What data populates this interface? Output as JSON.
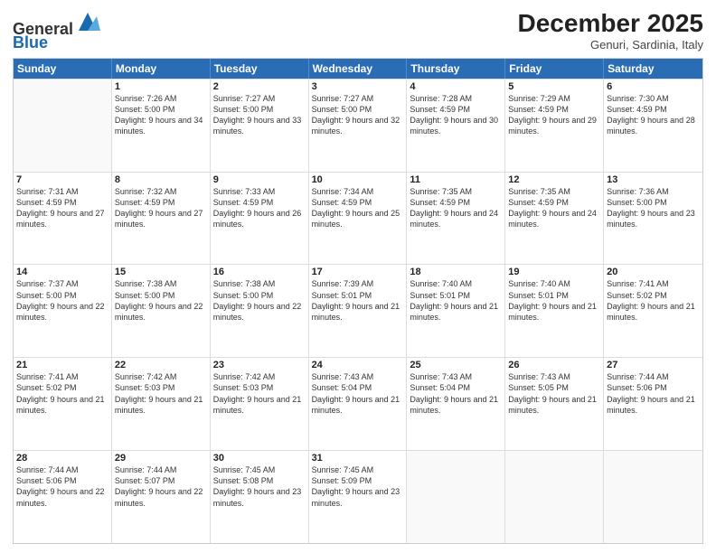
{
  "logo": {
    "general": "General",
    "blue": "Blue"
  },
  "title": "December 2025",
  "location": "Genuri, Sardinia, Italy",
  "days": [
    "Sunday",
    "Monday",
    "Tuesday",
    "Wednesday",
    "Thursday",
    "Friday",
    "Saturday"
  ],
  "weeks": [
    [
      {
        "num": "",
        "empty": true
      },
      {
        "num": "1",
        "sunrise": "7:26 AM",
        "sunset": "5:00 PM",
        "daylight": "9 hours and 34 minutes."
      },
      {
        "num": "2",
        "sunrise": "7:27 AM",
        "sunset": "5:00 PM",
        "daylight": "9 hours and 33 minutes."
      },
      {
        "num": "3",
        "sunrise": "7:27 AM",
        "sunset": "5:00 PM",
        "daylight": "9 hours and 32 minutes."
      },
      {
        "num": "4",
        "sunrise": "7:28 AM",
        "sunset": "4:59 PM",
        "daylight": "9 hours and 30 minutes."
      },
      {
        "num": "5",
        "sunrise": "7:29 AM",
        "sunset": "4:59 PM",
        "daylight": "9 hours and 29 minutes."
      },
      {
        "num": "6",
        "sunrise": "7:30 AM",
        "sunset": "4:59 PM",
        "daylight": "9 hours and 28 minutes."
      }
    ],
    [
      {
        "num": "7",
        "sunrise": "7:31 AM",
        "sunset": "4:59 PM",
        "daylight": "9 hours and 27 minutes."
      },
      {
        "num": "8",
        "sunrise": "7:32 AM",
        "sunset": "4:59 PM",
        "daylight": "9 hours and 27 minutes."
      },
      {
        "num": "9",
        "sunrise": "7:33 AM",
        "sunset": "4:59 PM",
        "daylight": "9 hours and 26 minutes."
      },
      {
        "num": "10",
        "sunrise": "7:34 AM",
        "sunset": "4:59 PM",
        "daylight": "9 hours and 25 minutes."
      },
      {
        "num": "11",
        "sunrise": "7:35 AM",
        "sunset": "4:59 PM",
        "daylight": "9 hours and 24 minutes."
      },
      {
        "num": "12",
        "sunrise": "7:35 AM",
        "sunset": "4:59 PM",
        "daylight": "9 hours and 24 minutes."
      },
      {
        "num": "13",
        "sunrise": "7:36 AM",
        "sunset": "5:00 PM",
        "daylight": "9 hours and 23 minutes."
      }
    ],
    [
      {
        "num": "14",
        "sunrise": "7:37 AM",
        "sunset": "5:00 PM",
        "daylight": "9 hours and 22 minutes."
      },
      {
        "num": "15",
        "sunrise": "7:38 AM",
        "sunset": "5:00 PM",
        "daylight": "9 hours and 22 minutes."
      },
      {
        "num": "16",
        "sunrise": "7:38 AM",
        "sunset": "5:00 PM",
        "daylight": "9 hours and 22 minutes."
      },
      {
        "num": "17",
        "sunrise": "7:39 AM",
        "sunset": "5:01 PM",
        "daylight": "9 hours and 21 minutes."
      },
      {
        "num": "18",
        "sunrise": "7:40 AM",
        "sunset": "5:01 PM",
        "daylight": "9 hours and 21 minutes."
      },
      {
        "num": "19",
        "sunrise": "7:40 AM",
        "sunset": "5:01 PM",
        "daylight": "9 hours and 21 minutes."
      },
      {
        "num": "20",
        "sunrise": "7:41 AM",
        "sunset": "5:02 PM",
        "daylight": "9 hours and 21 minutes."
      }
    ],
    [
      {
        "num": "21",
        "sunrise": "7:41 AM",
        "sunset": "5:02 PM",
        "daylight": "9 hours and 21 minutes."
      },
      {
        "num": "22",
        "sunrise": "7:42 AM",
        "sunset": "5:03 PM",
        "daylight": "9 hours and 21 minutes."
      },
      {
        "num": "23",
        "sunrise": "7:42 AM",
        "sunset": "5:03 PM",
        "daylight": "9 hours and 21 minutes."
      },
      {
        "num": "24",
        "sunrise": "7:43 AM",
        "sunset": "5:04 PM",
        "daylight": "9 hours and 21 minutes."
      },
      {
        "num": "25",
        "sunrise": "7:43 AM",
        "sunset": "5:04 PM",
        "daylight": "9 hours and 21 minutes."
      },
      {
        "num": "26",
        "sunrise": "7:43 AM",
        "sunset": "5:05 PM",
        "daylight": "9 hours and 21 minutes."
      },
      {
        "num": "27",
        "sunrise": "7:44 AM",
        "sunset": "5:06 PM",
        "daylight": "9 hours and 21 minutes."
      }
    ],
    [
      {
        "num": "28",
        "sunrise": "7:44 AM",
        "sunset": "5:06 PM",
        "daylight": "9 hours and 22 minutes."
      },
      {
        "num": "29",
        "sunrise": "7:44 AM",
        "sunset": "5:07 PM",
        "daylight": "9 hours and 22 minutes."
      },
      {
        "num": "30",
        "sunrise": "7:45 AM",
        "sunset": "5:08 PM",
        "daylight": "9 hours and 23 minutes."
      },
      {
        "num": "31",
        "sunrise": "7:45 AM",
        "sunset": "5:09 PM",
        "daylight": "9 hours and 23 minutes."
      },
      {
        "num": "",
        "empty": true
      },
      {
        "num": "",
        "empty": true
      },
      {
        "num": "",
        "empty": true
      }
    ]
  ]
}
